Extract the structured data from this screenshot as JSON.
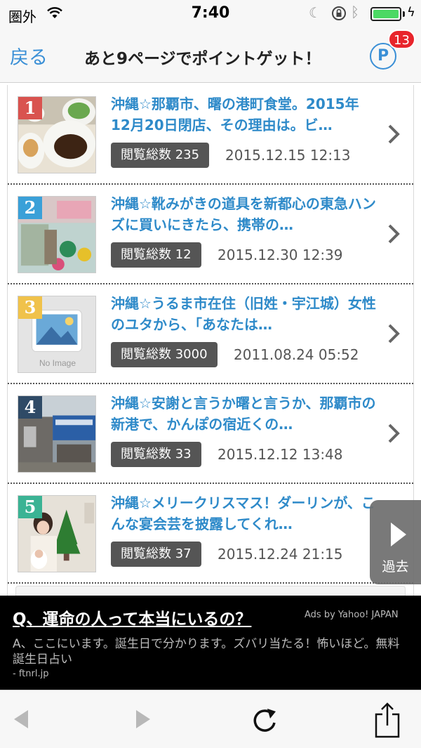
{
  "status_bar": {
    "carrier": "圏外",
    "time": "7:40",
    "icons": [
      "wifi-icon",
      "moon-icon",
      "orientation-lock-icon",
      "bluetooth-icon",
      "battery-icon",
      "charging-icon"
    ],
    "battery_level": 1.0
  },
  "nav": {
    "back_label": "戻る",
    "title": "あと9ページでポイントゲット！",
    "point_label": "P",
    "badge_count": "13"
  },
  "articles": [
    {
      "rank": "1",
      "title": "沖縄☆那覇市、曙の港町食堂。2015年12月20日閉店、その理由は。ビ…",
      "views": "閲覧総数 235",
      "date": "2015.12.15 12:13",
      "rank_color": "#d9534f"
    },
    {
      "rank": "2",
      "title": "沖縄☆靴みがきの道具を新都心の東急ハンズに買いにきたら、携帯の…",
      "views": "閲覧総数 12",
      "date": "2015.12.30 12:39",
      "rank_color": "#3aa0d8"
    },
    {
      "rank": "3",
      "title": "沖縄☆うるま市在住（旧姓・宇江城）女性のユタから、「あなたは…",
      "views": "閲覧総数 3000",
      "date": "2011.08.24 05:52",
      "rank_color": "#f0c24b",
      "thumb_caption": "No Image"
    },
    {
      "rank": "4",
      "title": "沖縄☆安謝と言うか曙と言うか、那覇市の新港で、かんぽの宿近くの…",
      "views": "閲覧総数 33",
      "date": "2015.12.12 13:48",
      "rank_color": "#2f4a66"
    },
    {
      "rank": "5",
      "title": "沖縄☆メリークリスマス！ダーリンが、こんな宴会芸を披露してくれ…",
      "views": "閲覧総数 37",
      "date": "2015.12.24 21:15",
      "rank_color": "#3bb394"
    }
  ],
  "past_tab": {
    "label": "過去"
  },
  "ad": {
    "title": "Q、運命の人って本当にいるの？",
    "attribution": "Ads by Yahoo! JAPAN",
    "body": "A、ここにいます。誕生日で分かります。ズバリ当たる！怖いほど。無料誕生日占い",
    "domain": "- ftnrl.jp"
  },
  "toolbar": {
    "buttons": [
      "back-arrow-icon",
      "forward-arrow-icon",
      "reload-icon",
      "share-icon"
    ]
  }
}
